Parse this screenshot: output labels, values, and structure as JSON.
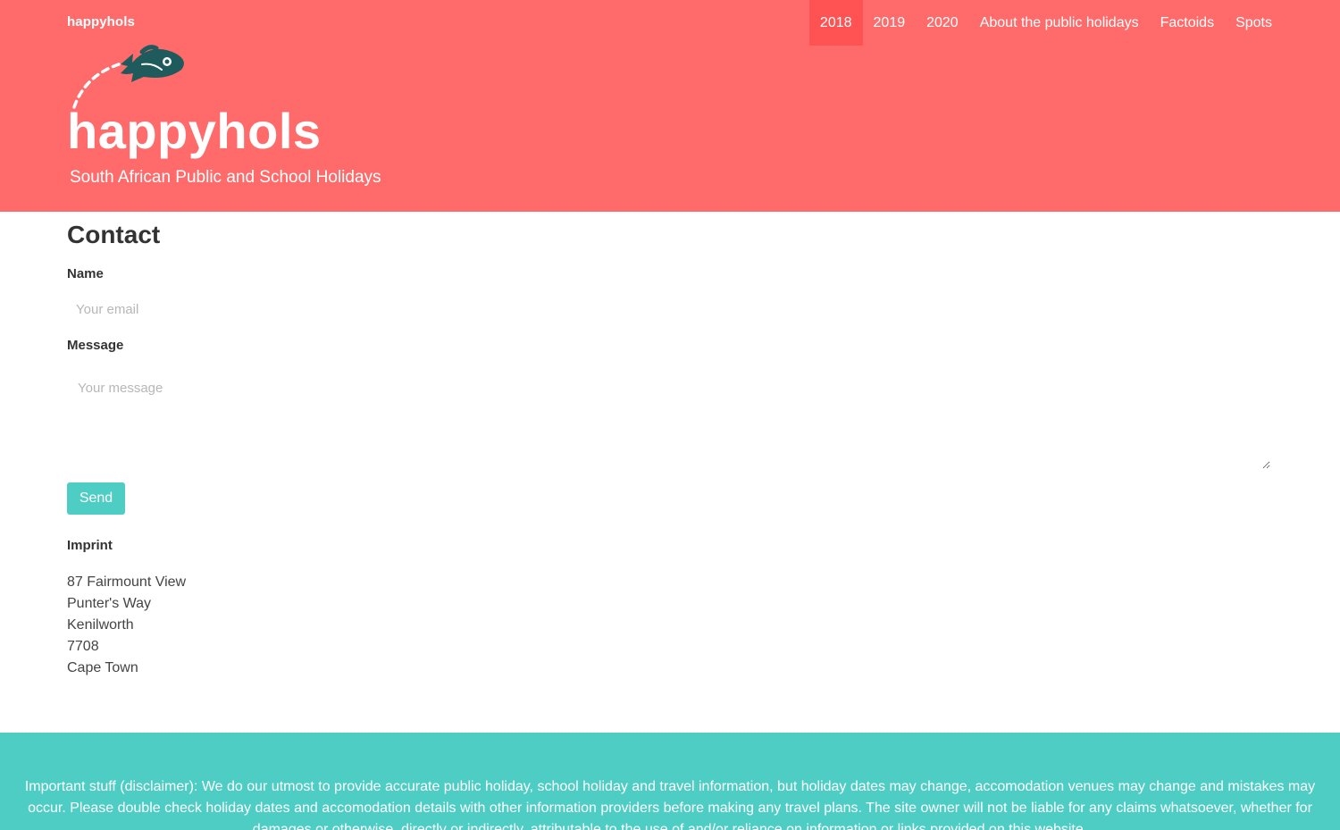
{
  "brand": "happyhols",
  "nav": [
    {
      "label": "2018",
      "active": true
    },
    {
      "label": "2019",
      "active": false
    },
    {
      "label": "2020",
      "active": false
    },
    {
      "label": "About the public holidays",
      "active": false
    },
    {
      "label": "Factoids",
      "active": false
    },
    {
      "label": "Spots",
      "active": false
    }
  ],
  "logo": {
    "text": "happyhols",
    "tagline": "South African Public and School Holidays",
    "icon": "fish-icon"
  },
  "contact": {
    "title": "Contact",
    "name_label": "Name",
    "name_placeholder": "Your email",
    "message_label": "Message",
    "message_placeholder": "Your message",
    "send_label": "Send"
  },
  "imprint": {
    "title": "Imprint",
    "lines": [
      "87 Fairmount View",
      "Punter's Way",
      "Kenilworth",
      "7708",
      "Cape Town"
    ]
  },
  "footer": {
    "disclaimer": "Important stuff (disclaimer): We do our utmost to provide accurate public holiday, school holiday and travel information, but holiday dates may change, accomodation venues may change and mistakes may occur. Please double check holiday dates and accomodation details with other information providers before making any travel plans. The site owner will not be liable for any claims whatsoever, whether for damages or otherwise, directly or indirectly, attributable to the use of and/or reliance on information or links provided on this website."
  },
  "colors": {
    "header": "#ff6b6b",
    "nav_active": "#ff5252",
    "accent": "#4ecdc4",
    "fish": "#1f5a5c"
  }
}
